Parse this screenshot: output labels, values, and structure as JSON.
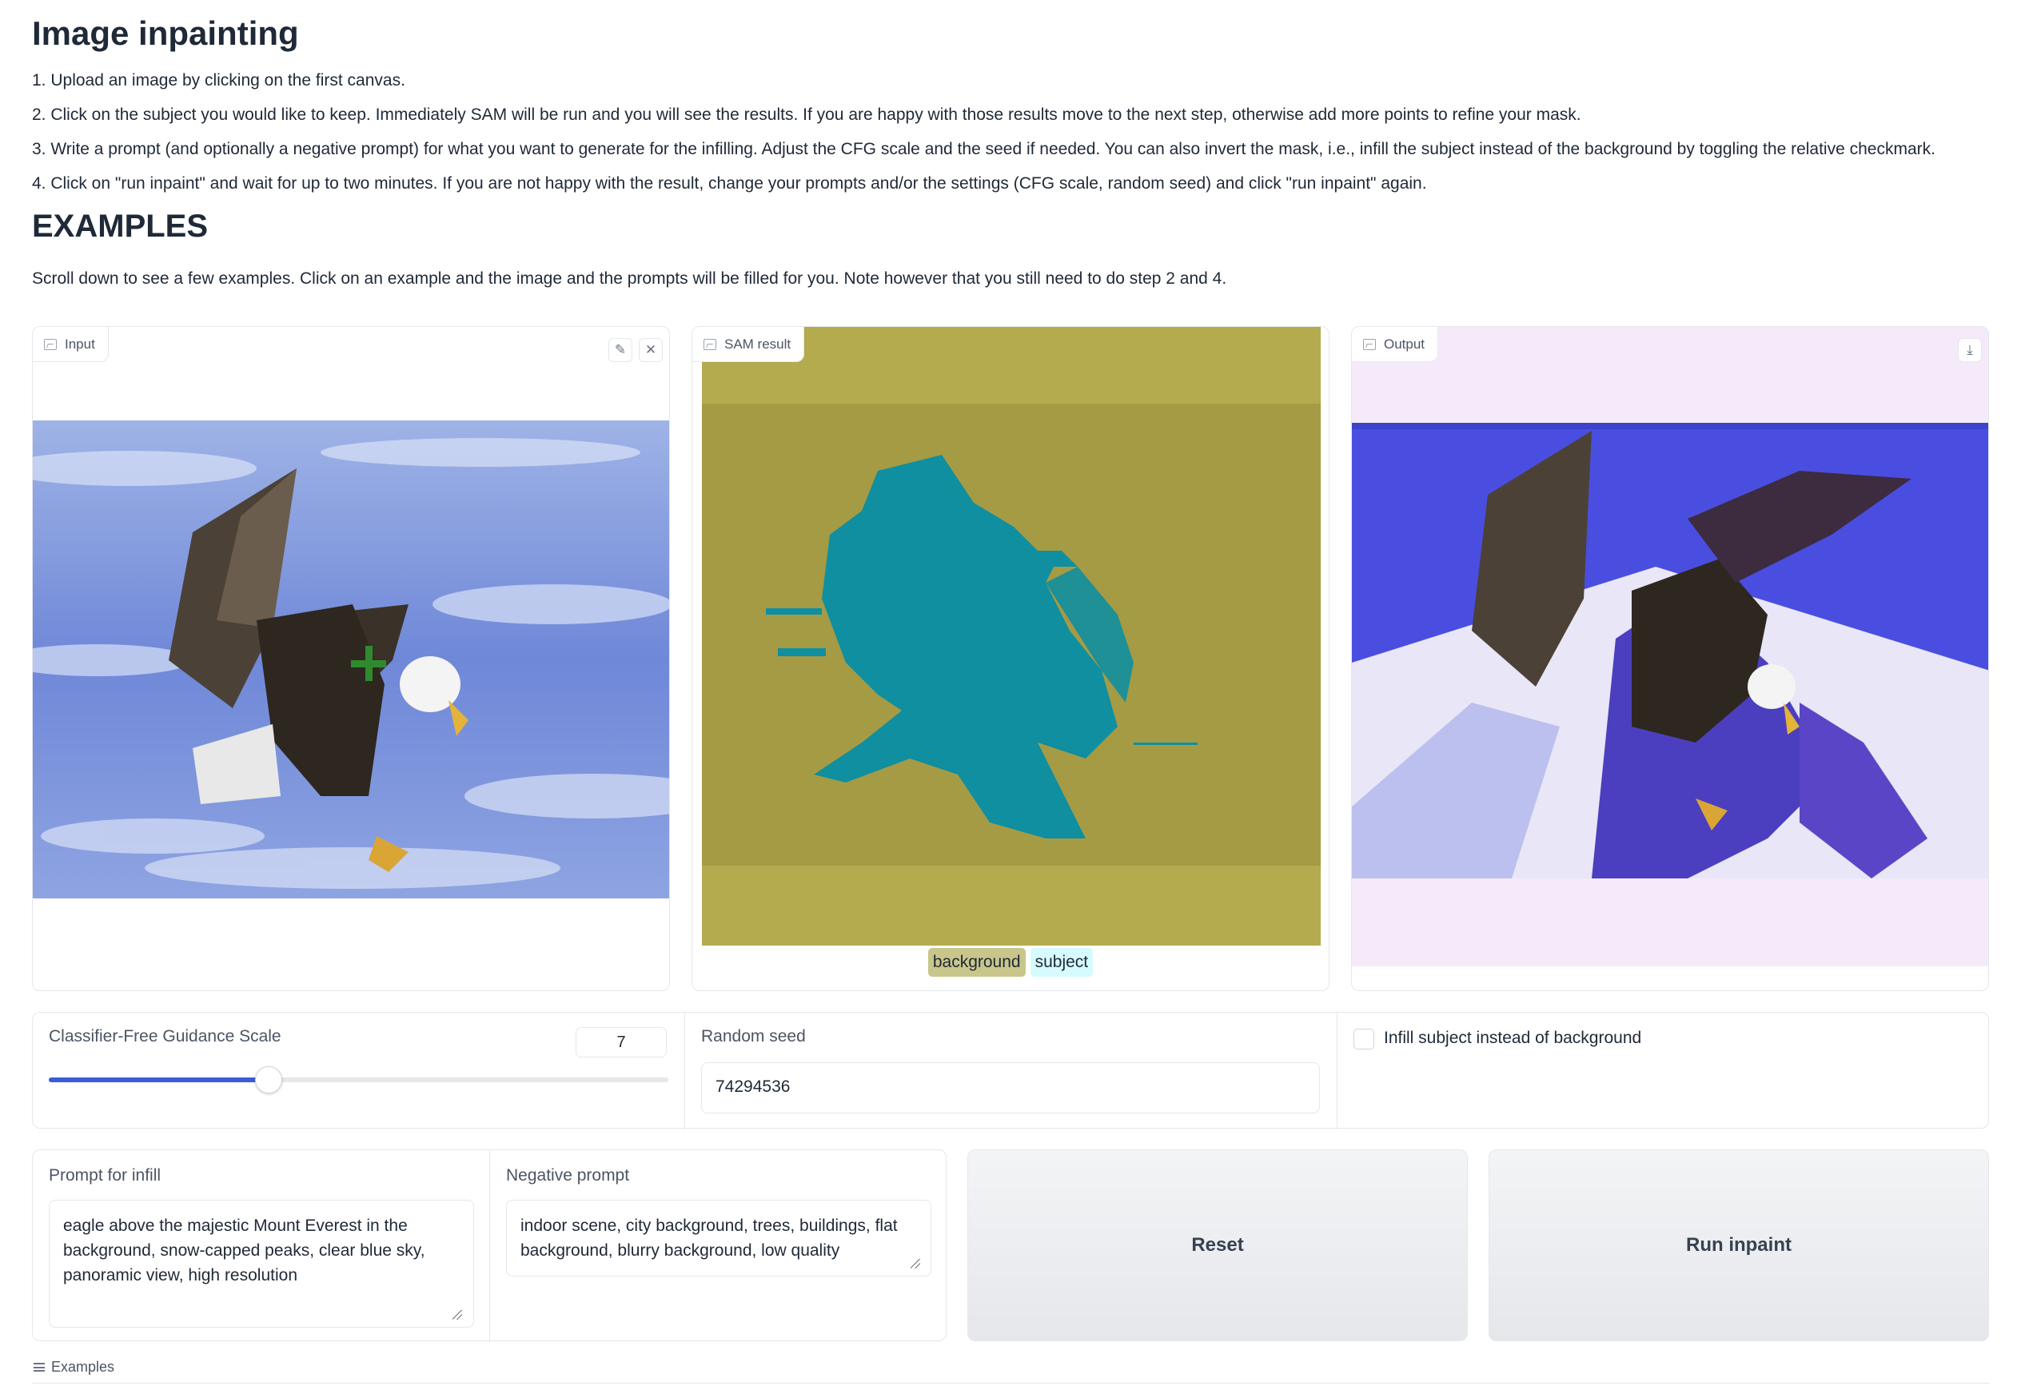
{
  "header": {
    "title": "Image inpainting",
    "steps": [
      "1. Upload an image by clicking on the first canvas.",
      "2. Click on the subject you would like to keep. Immediately SAM will be run and you will see the results. If you are happy with those results move to the next step, otherwise add more points to refine your mask.",
      "3. Write a prompt (and optionally a negative prompt) for what you want to generate for the infilling. Adjust the CFG scale and the seed if needed. You can also invert the mask, i.e., infill the subject instead of the background by toggling the relative checkmark.",
      "4. Click on \"run inpaint\" and wait for up to two minutes. If you are not happy with the result, change your prompts and/or the settings (CFG scale, random seed) and click \"run inpaint\" again."
    ],
    "examples_heading": "EXAMPLES",
    "examples_note": "Scroll down to see a few examples. Click on an example and the image and the prompts will be filled for you. Note however that you still need to do step 2 and 4."
  },
  "panels": {
    "input": {
      "label": "Input",
      "icons": [
        "image-icon",
        "edit-icon",
        "close-icon"
      ]
    },
    "sam": {
      "label": "SAM result",
      "legend": [
        {
          "label": "background",
          "color": "#c9c68b"
        },
        {
          "label": "subject",
          "color": "#d6fbff"
        }
      ]
    },
    "output": {
      "label": "Output",
      "icons": [
        "image-icon",
        "download-icon"
      ]
    }
  },
  "controls": {
    "cfg": {
      "label": "Classifier-Free Guidance Scale",
      "value": "7",
      "slider_fraction": 0.355
    },
    "seed": {
      "label": "Random seed",
      "value": "74294536"
    },
    "invert": {
      "label": "Infill subject instead of background",
      "checked": false
    }
  },
  "prompts": {
    "prompt": {
      "label": "Prompt for infill",
      "value": "eagle above the majestic Mount Everest in the background, snow-capped peaks, clear blue sky, panoramic view, high resolution"
    },
    "negative": {
      "label": "Negative prompt",
      "value": "indoor scene, city background, trees, buildings, flat background, blurry background, low quality"
    }
  },
  "buttons": {
    "reset": "Reset",
    "run": "Run inpaint"
  },
  "examples": {
    "label": "Examples"
  },
  "colors": {
    "accent": "#3b5bdb",
    "sam_background": "#b3ab4e",
    "sam_subject": "#0f8f9f",
    "output_bg": "#f5eaf9"
  }
}
